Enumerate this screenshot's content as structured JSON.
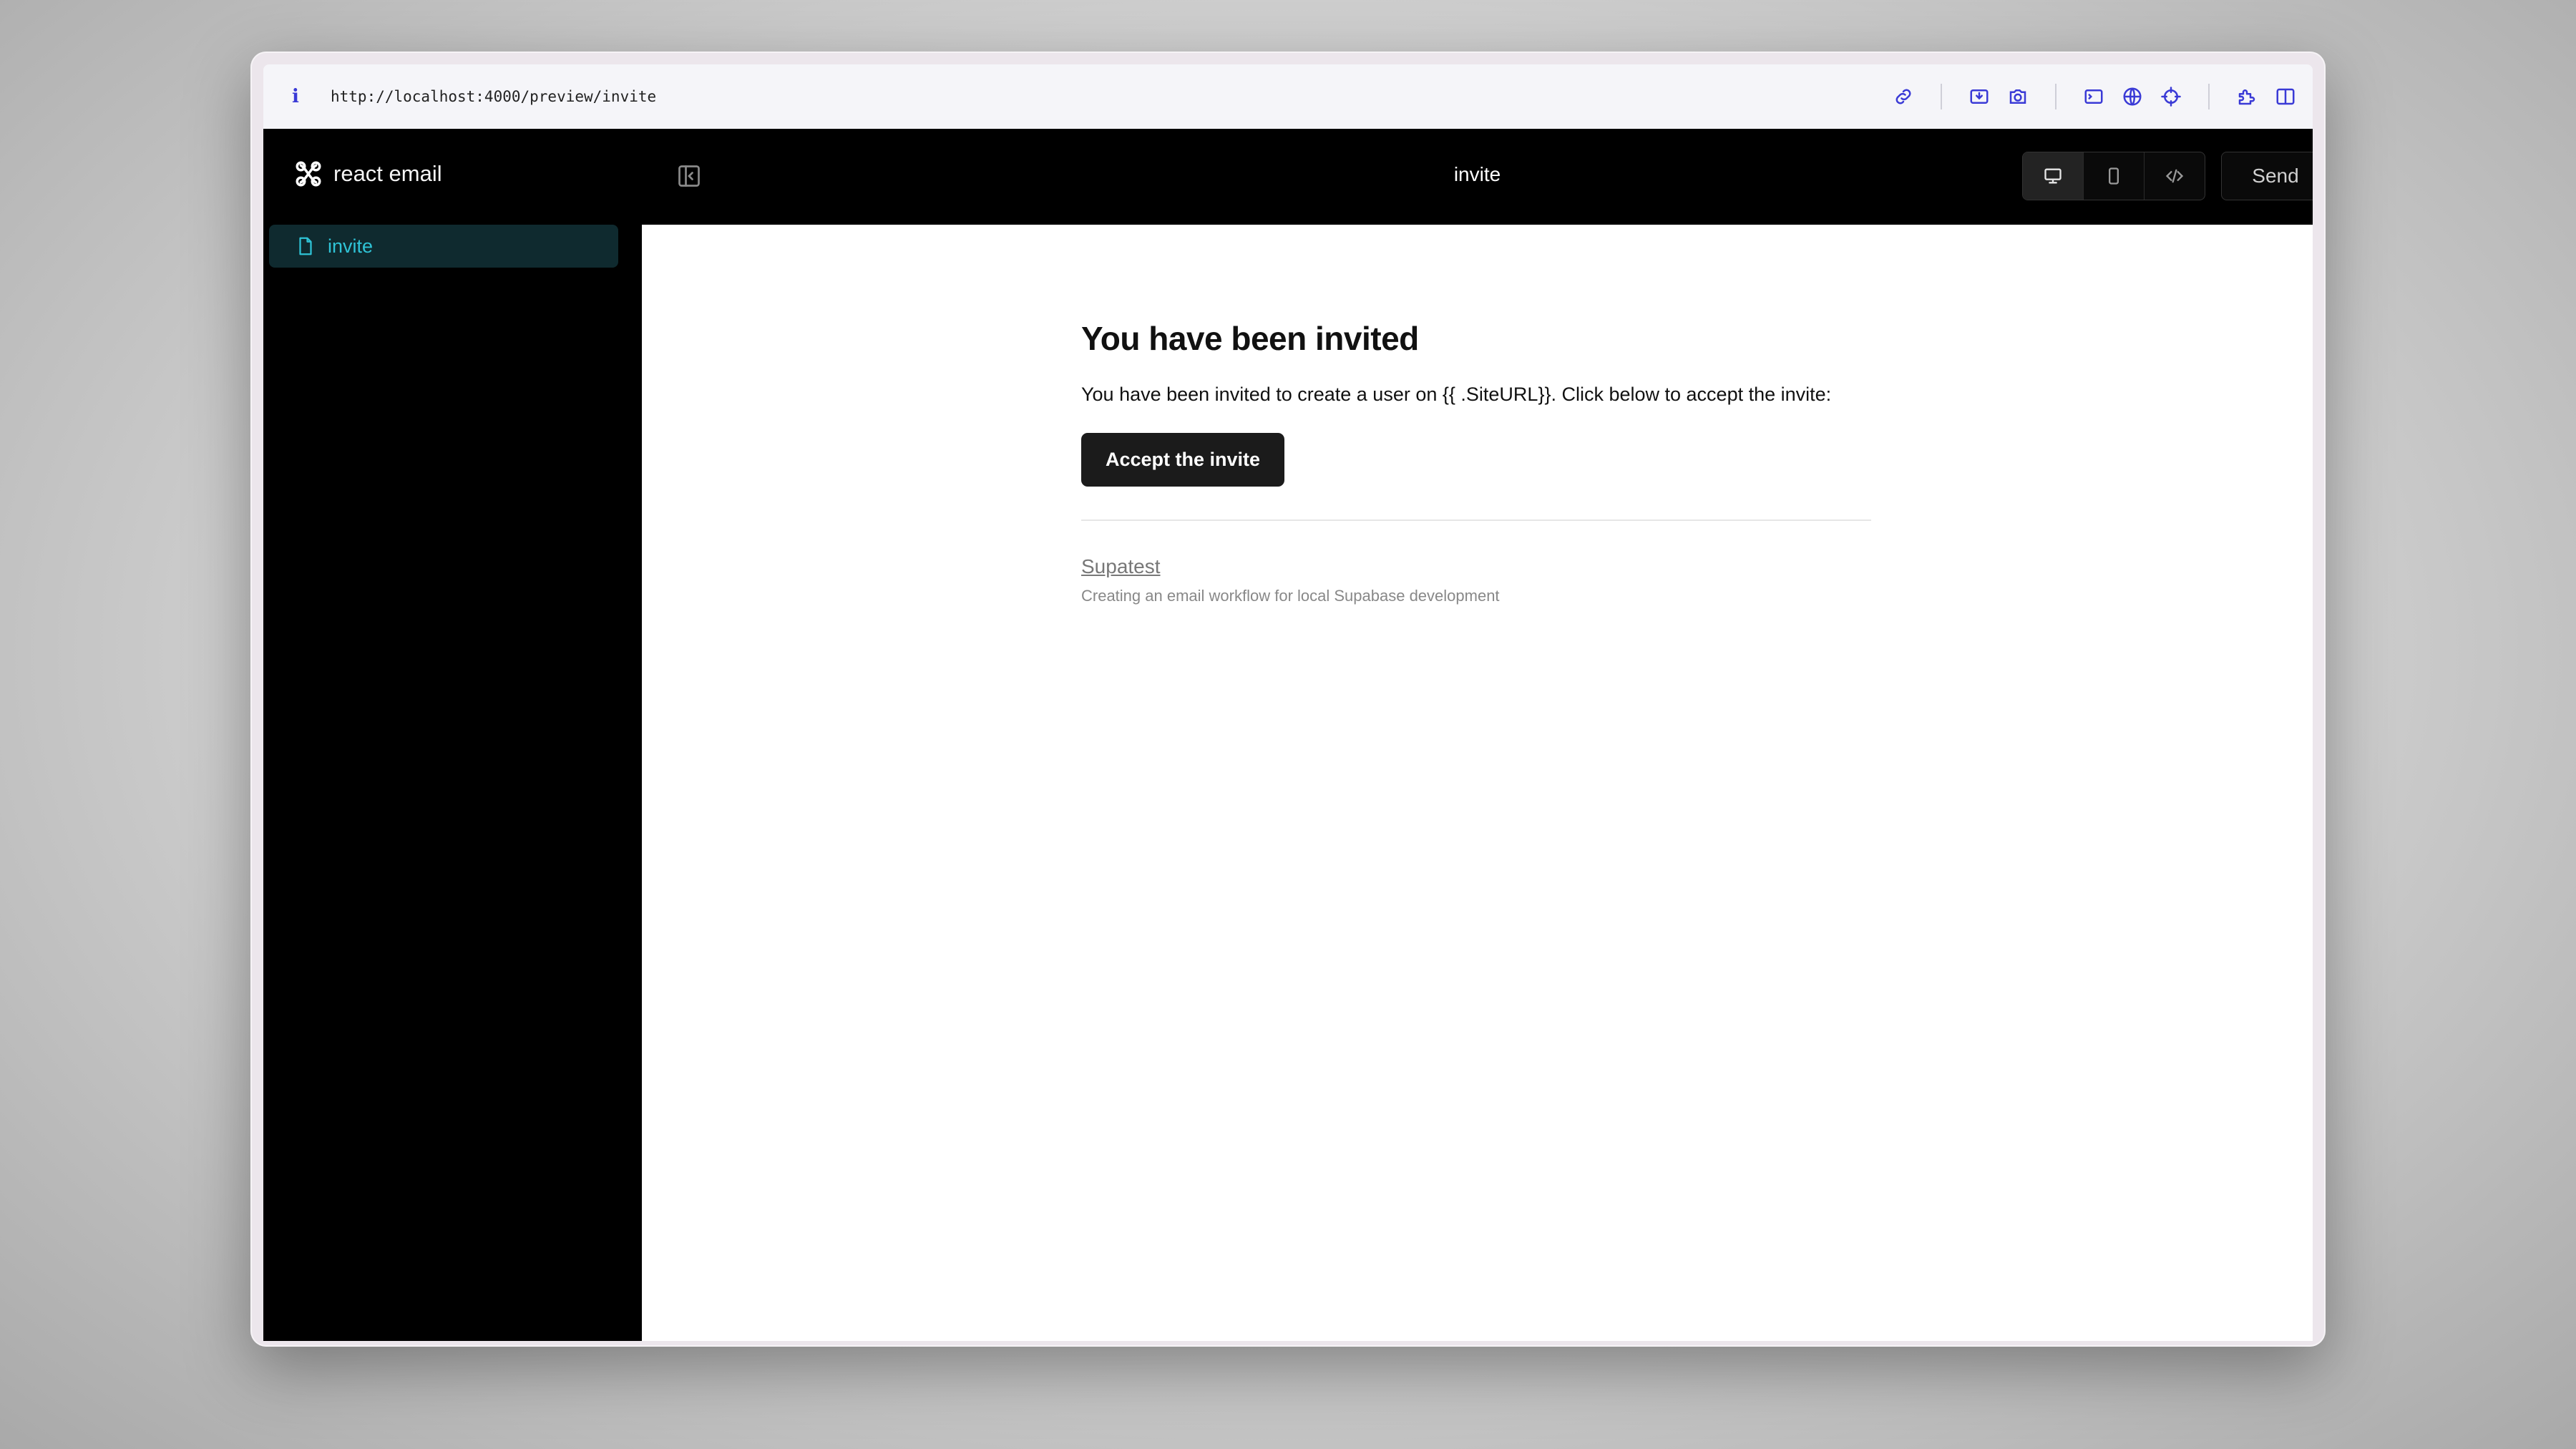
{
  "browser": {
    "url": "http://localhost:4000/preview/invite",
    "icons": [
      "link-icon",
      "download-icon",
      "camera-icon",
      "terminal-icon",
      "globe-icon",
      "crosshair-icon",
      "extension-icon",
      "split-view-icon"
    ]
  },
  "sidebar": {
    "brand": "react email",
    "items": [
      {
        "label": "invite",
        "active": true,
        "icon": "file-icon"
      }
    ]
  },
  "topbar": {
    "title": "invite",
    "view_modes": [
      "desktop-icon",
      "mobile-icon",
      "code-icon"
    ],
    "active_view": "desktop",
    "send_label": "Send"
  },
  "email": {
    "heading": "You have been invited",
    "body": "You have been invited to create a user on {{ .SiteURL}}. Click below to accept the invite:",
    "cta_label": "Accept the invite",
    "footer_link": "Supatest",
    "footer_text": "Creating an email workflow for local Supabase development"
  },
  "colors": {
    "accent": "#2fc3d6",
    "active_item_bg": "#0f2a2f",
    "browser_icon": "#3a3ad6",
    "button_bg": "#1b1b1b"
  }
}
